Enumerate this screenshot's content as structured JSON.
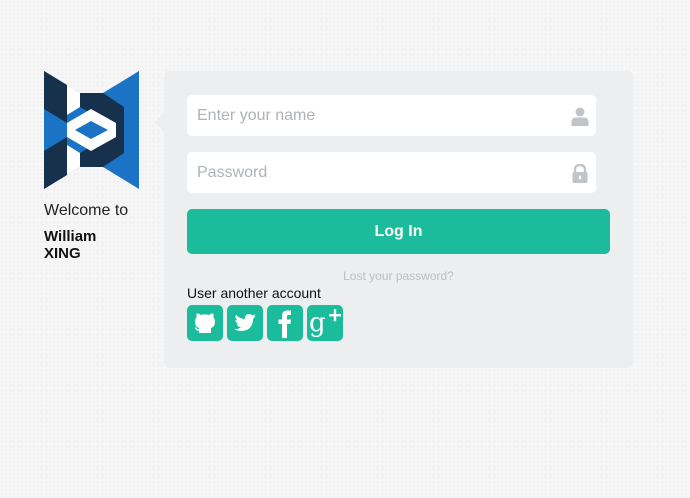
{
  "brand": {
    "logo_icon": "bootstrap-style-x-logo-icon",
    "colors": {
      "logo_dark": "#17314d",
      "logo_blue": "#1a73c4",
      "accent": "#1abc9c"
    }
  },
  "sidebar": {
    "welcome": "Welcome to",
    "user_name": "William XING"
  },
  "form": {
    "name_placeholder": "Enter your name",
    "name_value": "",
    "name_icon": "user-icon",
    "password_placeholder": "Password",
    "password_value": "",
    "password_icon": "lock-icon",
    "login_label": "Log In",
    "lost_password": "Lost your password?"
  },
  "social": {
    "label": "User another account",
    "providers": [
      {
        "name": "GitHub",
        "icon": "github-icon"
      },
      {
        "name": "Twitter",
        "icon": "twitter-icon"
      },
      {
        "name": "Facebook",
        "icon": "facebook-icon"
      },
      {
        "name": "Google Plus",
        "icon": "google-plus-icon"
      }
    ]
  }
}
